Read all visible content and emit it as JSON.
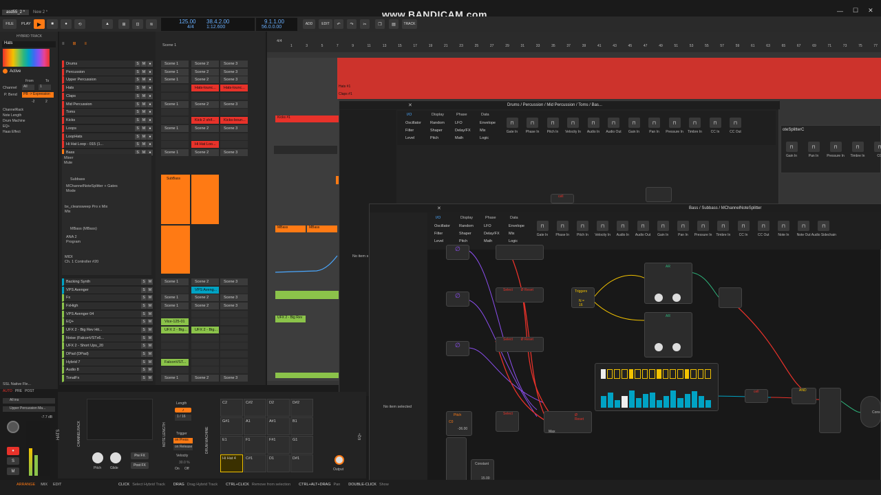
{
  "app": {
    "tabs": [
      "asd55_2 *",
      "New 2 *"
    ],
    "watermark": "www.BANDICAM.com",
    "toolbar": {
      "file": "FILE",
      "play": "PLAY",
      "add": "ADD",
      "edit": "EDIT",
      "track": "TRACK"
    },
    "transport": {
      "tempo": "125.00",
      "signature": "4/4",
      "position": "38.4.2.00",
      "time": "1:12.600",
      "loop_start": "9.1.1.00",
      "loop_len": "56.0.0.00"
    }
  },
  "inspector": {
    "title": "HYBRID TRACK",
    "name": "Hats",
    "active": "Active",
    "channel_label": "Channel",
    "from": "From",
    "to": "To",
    "ch_from": "All",
    "ch_to": "1",
    "pbend_label": "P. Bend",
    "pbend_value": "PB -> Expression",
    "pb_from": "-2",
    "pb_to": "2",
    "devices": [
      "ChannelRack",
      "Note Length",
      "Drum Machine",
      "EQ+",
      "Haas Effect"
    ],
    "bottom_device": "SSL Native Fle...",
    "io": {
      "auto": "AUTO",
      "pre": "PRE",
      "post": "POST",
      "all_ins": "All ins",
      "output": "Upper Percussion Ma..."
    },
    "level": "-7.7 dB",
    "m": "M",
    "s": "S"
  },
  "tracks": [
    {
      "name": "Drums",
      "scenes": [
        "Scene 1",
        "Scene 2",
        "Scene 3"
      ]
    },
    {
      "name": "Percussion",
      "scenes": [
        "Scene 1",
        "Scene 2",
        "Scene 3"
      ]
    },
    {
      "name": "Upper Percussion",
      "scenes": [
        "Scene 1",
        "Scene 2",
        "Scene 3"
      ]
    },
    {
      "name": "Hats",
      "scenes": [
        "",
        "Hats-lounc...",
        "Hats-lounc..."
      ]
    },
    {
      "name": "Claps",
      "scenes": [
        "",
        "",
        ""
      ]
    },
    {
      "name": "Mid Percussion",
      "scenes": [
        "Scene 1",
        "Scene 2",
        "Scene 3"
      ]
    },
    {
      "name": "Toms",
      "scenes": [
        "",
        "",
        ""
      ]
    },
    {
      "name": "Kicks",
      "scenes": [
        "",
        "Kick 2 shif...",
        "Kicks-boun..."
      ]
    },
    {
      "name": "Loops",
      "scenes": [
        "Scene 1",
        "Scene 2",
        "Scene 3"
      ]
    },
    {
      "name": "LoopHats",
      "scenes": [
        "",
        "",
        ""
      ]
    },
    {
      "name": "Hi Hat Loop - 015 (1...",
      "scenes": [
        "",
        "Hi Hat Loo...",
        ""
      ]
    },
    {
      "name": "Bass",
      "scenes": [
        "Scene 1",
        "Scene 2",
        "Scene 3"
      ]
    }
  ],
  "bass_devices": {
    "mixer": "Mixer",
    "mute": "Mute",
    "subbass": "Subbass",
    "splitter": "MChannelNoteSplitter + Gates",
    "mode": "Mode",
    "sweep": "bx_cleansweep Pro x Mix",
    "mix": "Mix",
    "mbass": "MBass (MBass)",
    "ana": "ANA 2",
    "program": "Program",
    "midi": "MIDI",
    "cc": "Ch. 1 Controller #20"
  },
  "tracks2": [
    {
      "name": "Backing Synth",
      "scenes": [
        "Scene 1",
        "Scene 2",
        "Scene 3"
      ]
    },
    {
      "name": "VPS Avenger",
      "scenes": [
        "",
        "VPS Aveng...",
        ""
      ]
    },
    {
      "name": "Fx",
      "scenes": [
        "Scene 1",
        "Scene 2",
        "Scene 3"
      ]
    },
    {
      "name": "FxHigh",
      "scenes": [
        "Scene 1",
        "Scene 2",
        "Scene 3"
      ]
    },
    {
      "name": "VPS Avenger 04",
      "scenes": [
        "",
        "",
        ""
      ]
    },
    {
      "name": "EQ+",
      "scenes": [
        "Vice-125-01",
        "",
        ""
      ]
    },
    {
      "name": "UFX 2 - Big Rev Hit...",
      "scenes": [
        "UFX 2 - Big...",
        "UFX 2 - Big...",
        ""
      ]
    },
    {
      "name": "Noise (FalconVSTx6...",
      "scenes": [
        "",
        "",
        ""
      ]
    },
    {
      "name": "UFX 2 - Short Ups_20",
      "scenes": [
        "",
        "",
        ""
      ]
    },
    {
      "name": "DPad (DPad)",
      "scenes": [
        "",
        "",
        ""
      ]
    },
    {
      "name": "Hybrid 7",
      "scenes": [
        "FalconVST...",
        "",
        ""
      ]
    },
    {
      "name": "Audio 8",
      "scenes": [
        "",
        "",
        ""
      ]
    },
    {
      "name": "TonalFx",
      "scenes": [
        "Scene 1",
        "Scene 2",
        "Scene 3"
      ]
    }
  ],
  "arranger": {
    "signature": "4/4",
    "ruler": [
      "1",
      "3",
      "5",
      "7",
      "9",
      "11",
      "13",
      "15",
      "17",
      "19",
      "21",
      "23",
      "25",
      "27",
      "29",
      "31",
      "33",
      "35",
      "37",
      "39",
      "41",
      "43",
      "45",
      "47",
      "49",
      "51",
      "53",
      "55",
      "57",
      "59",
      "61",
      "63",
      "65",
      "67",
      "69",
      "71",
      "73",
      "75",
      "77"
    ],
    "clips": {
      "hats": "Hats #1",
      "claps": "Claps #1",
      "kicks": "Kicks #1",
      "mbass1": "MBass",
      "mbass2": "MBass",
      "ufx": "UFX 2 - Big Rev",
      "subbass": "SubBass"
    }
  },
  "grid1": {
    "title": "Drums / Percussion / Mid Percussion / Toms / Bas...",
    "tabs": [
      "I/O",
      "Display",
      "Phase",
      "Data"
    ],
    "cats": [
      [
        "Oscillator",
        "Random",
        "LFO",
        "Envelope"
      ],
      [
        "Filter",
        "Shaper",
        "Delay/FX",
        "Mix"
      ],
      [
        "Level",
        "Pitch",
        "Math",
        "Logic"
      ]
    ],
    "io": [
      "Gate In",
      "Phase In",
      "Pitch In",
      "Velocity In",
      "Audio In",
      "Audio Out",
      "Gain In",
      "Pan In",
      "Pressure In",
      "Timbre In",
      "CC In",
      "CC Out"
    ],
    "node_cell": "cell"
  },
  "grid2": {
    "title": "Bass / Subbass / MChannelNoteSplitter",
    "left_text": "No item selected",
    "tabs": [
      "I/O",
      "Display",
      "Phase",
      "Data"
    ],
    "cats": [
      [
        "Oscillator",
        "Random",
        "LFO",
        "Envelope"
      ],
      [
        "Filter",
        "Shaper",
        "Delay/FX",
        "Mix"
      ],
      [
        "Level",
        "Pitch",
        "Math",
        "Logic"
      ]
    ],
    "io": [
      "Gate In",
      "Phase In",
      "Pitch In",
      "Velocity In",
      "Audio In",
      "Audio Out",
      "Gain In",
      "Pan In",
      "Pressure In",
      "Timbre In",
      "CC In",
      "CC Out",
      "Note In",
      "Note Out",
      "Audio Sidechain"
    ],
    "nodes": {
      "select": "Select",
      "reset": "Ø Reset",
      "triggers": "Triggers",
      "n16": "N = 16",
      "ar": "AR",
      "a": "A",
      "r": "R",
      "pitch": "Pitch",
      "c0": "C0",
      "val": "-36.00",
      "constant": "Constant",
      "cval": "15.00",
      "max": "Max",
      "and": "AND",
      "cell": "cell",
      "const_short": "Cons"
    }
  },
  "grid_peek": {
    "title": "oteSplitterC",
    "io": [
      "Gain In",
      "Pan In",
      "Pressure In",
      "Timbre In",
      "CC"
    ]
  },
  "side_panel": {
    "no_item": "No item selected",
    "no_item_short": "No item s"
  },
  "bottom": {
    "channelrack": "CHANNELRACK",
    "hats": "HATS",
    "notelength": "NOTE LENGTH",
    "drummachine": "DRUM MACHINE",
    "eq": "EQ+",
    "pitch": "Pitch",
    "glide": "Glide",
    "prefx": "Pre FX",
    "postfx": "Post FX",
    "length": "Length",
    "len_val": "1 / 16",
    "trigger": "Trigger",
    "on_press": "on Press",
    "on_release": "on Release",
    "velocity": "Velocity",
    "vel_val": "30.0 %",
    "on": "On",
    "off": "Off",
    "pads": [
      "C2",
      "C#2",
      "D2",
      "D#2",
      "G#1",
      "A1",
      "A#1",
      "B1",
      "E1",
      "F1",
      "F#1",
      "G1",
      "Hi Hat 4",
      "C#1",
      "D1",
      "D#1"
    ],
    "output": "Output"
  },
  "statusbar": {
    "views": [
      "ARRANGE",
      "MIX",
      "EDIT"
    ],
    "hints": [
      [
        "CLICK",
        "Select Hybrid Track"
      ],
      [
        "DRAG",
        "Drag Hybrid Track"
      ],
      [
        "CTRL+CLICK",
        "Remove from selection"
      ],
      [
        "CTRL+ALT+DRAG",
        "Pan"
      ],
      [
        "DOUBLE-CLICK",
        "Show"
      ]
    ]
  }
}
